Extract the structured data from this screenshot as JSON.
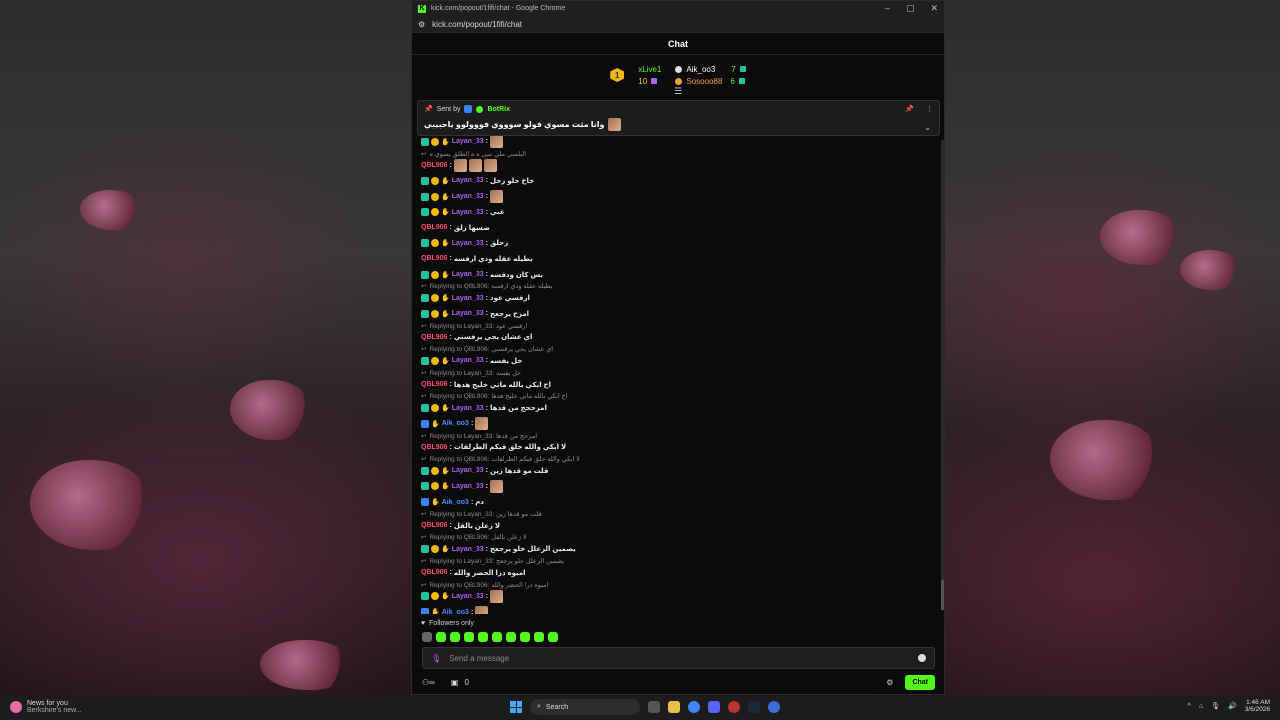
{
  "browser": {
    "title": "kick.com/popout/1fifi/chat - Google Chrome",
    "url": "kick.com/popout/1fifi/chat"
  },
  "chat": {
    "header": "Chat",
    "leaderboard": {
      "rank": "1",
      "first_user": "xLive1",
      "first_value": "10",
      "second_user": "Aik_oo3",
      "second_value": "7",
      "third_user": "Sosooo88",
      "third_value": "6"
    },
    "pinned": {
      "sent_by_label": "Sent by",
      "sender": "BotRix",
      "message": "وانا مثت مسوي فولو سوووي فووولوو ياحبيبي"
    },
    "messages": [
      {
        "user": "Layan_33",
        "color": "layan",
        "text": "",
        "emote": true,
        "badges": [
          "sub",
          "coin",
          "hand"
        ]
      },
      {
        "reply": "البلسي ملي سي ه ه الطلق يسوي ه"
      },
      {
        "user": "QBL906",
        "color": "qbl",
        "text": "",
        "emote": true,
        "emotes": 3
      },
      {
        "user": "Layan_33",
        "color": "layan",
        "text": "خاخ خلو زحل",
        "badges": [
          "sub",
          "coin",
          "hand"
        ]
      },
      {
        "user": "Layan_33",
        "color": "layan",
        "text": "",
        "emote": true,
        "badges": [
          "sub",
          "coin",
          "hand"
        ]
      },
      {
        "user": "Layan_33",
        "color": "layan",
        "text": "غبي",
        "badges": [
          "sub",
          "coin",
          "hand"
        ]
      },
      {
        "user": "QBL906",
        "color": "qbl",
        "text": "ضسها زلق"
      },
      {
        "user": "Layan_33",
        "color": "layan",
        "text": "زحلق",
        "badges": [
          "sub",
          "coin",
          "hand"
        ]
      },
      {
        "user": "QBL906",
        "color": "qbl",
        "text": "بطيله عقله ودي ارفسه"
      },
      {
        "user": "Layan_33",
        "color": "layan",
        "text": "بس كان ودفسه",
        "badges": [
          "sub",
          "coin",
          "hand"
        ]
      },
      {
        "reply": "Replying to QBL906: بطيله عقله ودي ارفسه"
      },
      {
        "user": "Layan_33",
        "color": "layan",
        "text": "ارفسي عود",
        "badges": [
          "sub",
          "coin",
          "hand"
        ]
      },
      {
        "user": "Layan_33",
        "color": "layan",
        "text": "امزح يرجعج",
        "badges": [
          "sub",
          "coin",
          "hand"
        ]
      },
      {
        "reply": "Replying to Layan_33: ارفسي عود"
      },
      {
        "user": "QBL906",
        "color": "qbl",
        "text": "اي عشان يجي يرفسني"
      },
      {
        "reply": "Replying to QBL906: اي عشان يجي يرفسني"
      },
      {
        "user": "Layan_33",
        "color": "layan",
        "text": "خل يفسه",
        "badges": [
          "sub",
          "coin",
          "hand"
        ]
      },
      {
        "reply": "Replying to Layan_33: خل يفسه"
      },
      {
        "user": "QBL906",
        "color": "qbl",
        "text": "اح ابكي بالله ماتي خليج هدها"
      },
      {
        "reply": "Replying to QBL906: اح ابكي بالله ماتي خليج هدها"
      },
      {
        "user": "Layan_33",
        "color": "layan",
        "text": "امزحجج من قدها",
        "badges": [
          "sub",
          "coin",
          "hand"
        ]
      },
      {
        "user": "Aik_oo3",
        "color": "aik",
        "text": "",
        "emote": true,
        "badges": [
          "gift",
          "hand"
        ]
      },
      {
        "reply": "Replying to Layan_33: امزحج من قدها"
      },
      {
        "user": "QBL906",
        "color": "qbl",
        "text": "لا ابكي والله حلق فيكم الطرلقات"
      },
      {
        "reply": "Replying to QBL906: لا ابكي والله حلق فيكم الطرلقات"
      },
      {
        "user": "Layan_33",
        "color": "layan",
        "text": "قلت مو قدها زين",
        "badges": [
          "sub",
          "coin",
          "hand"
        ]
      },
      {
        "user": "Layan_33",
        "color": "layan",
        "text": "",
        "emote": true,
        "badges": [
          "sub",
          "coin",
          "hand"
        ]
      },
      {
        "user": "Aik_oo3",
        "color": "aik",
        "text": "دم",
        "badges": [
          "gift",
          "hand"
        ]
      },
      {
        "reply": "Replying to Layan_33: قلت مو قدها زين"
      },
      {
        "user": "QBL906",
        "color": "qbl",
        "text": "لا زعلن بالقل"
      },
      {
        "reply": "Replying to QBL906: لا زعلن بالقل"
      },
      {
        "user": "Layan_33",
        "color": "layan",
        "text": "يصمين الزعلل خلو يرجعج",
        "badges": [
          "sub",
          "coin",
          "hand"
        ]
      },
      {
        "reply": "Replying to Layan_33: يصمين الزعلل خلو يرجعج"
      },
      {
        "user": "QBL906",
        "color": "qbl",
        "text": "امبوه ذرا الحضر والله"
      },
      {
        "reply": "Replying to QBL906: امبوه ذرا الحضر والله"
      },
      {
        "user": "Layan_33",
        "color": "layan",
        "text": "",
        "emote": true,
        "badges": [
          "sub",
          "coin",
          "hand"
        ]
      },
      {
        "user": "Aik_oo3",
        "color": "aik",
        "text": "",
        "emote": true,
        "badges": [
          "gift",
          "hand"
        ]
      }
    ],
    "followers_only": "Followers only",
    "input_placeholder": "Send a message",
    "points_value": "0",
    "chat_button": "Chat"
  },
  "taskbar": {
    "news_title": "News for you",
    "news_sub": "Berkshire's new...",
    "search_label": "Search",
    "time": "1:46 AM",
    "date": "3/6/2026"
  }
}
